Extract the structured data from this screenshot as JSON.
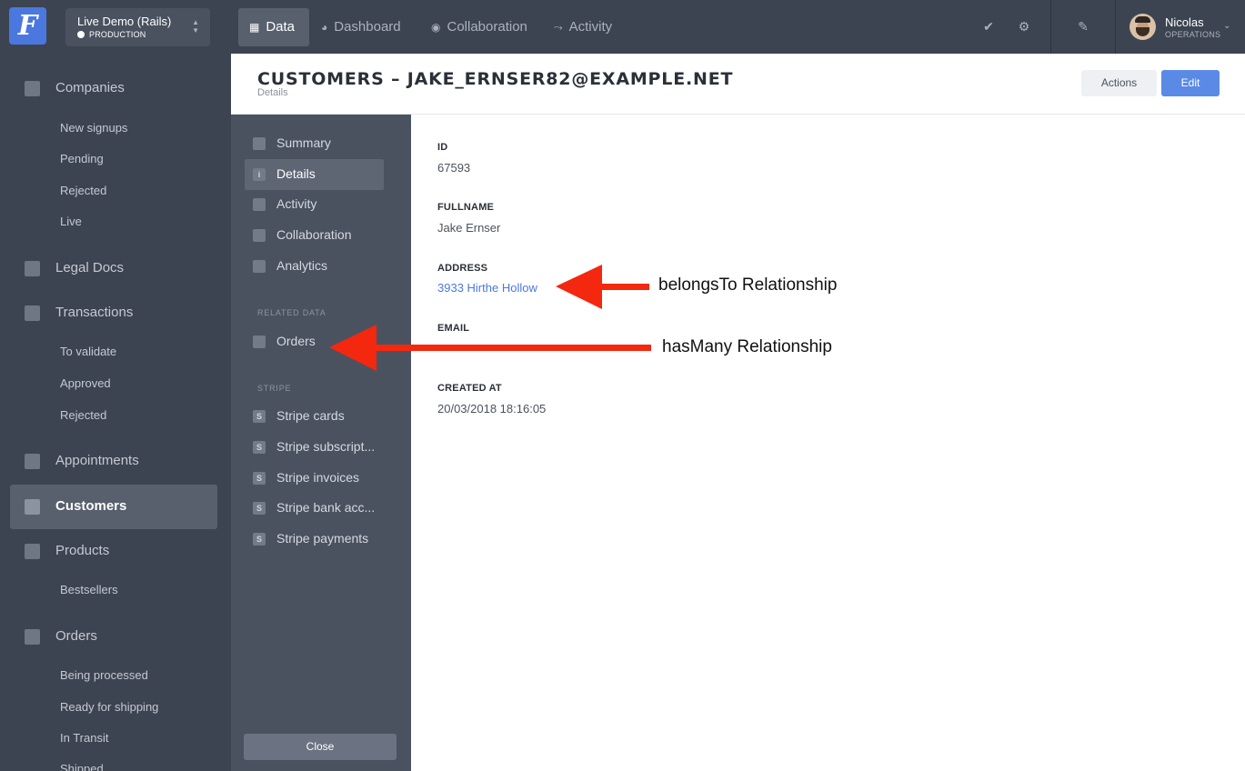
{
  "app": {
    "logo_letter": "F",
    "project_name": "Live Demo (Rails)",
    "project_env": "PRODUCTION"
  },
  "topnav": {
    "tabs": [
      {
        "label": "Data",
        "icon": "table-icon"
      },
      {
        "label": "Dashboard",
        "icon": "dashboard-icon"
      },
      {
        "label": "Collaboration",
        "icon": "chat-icon"
      },
      {
        "label": "Activity",
        "icon": "bolt-icon"
      }
    ],
    "user_name": "Nicolas",
    "user_role": "OPERATIONS"
  },
  "sidebar": {
    "companies": {
      "label": "Companies",
      "subs": [
        "New signups",
        "Pending",
        "Rejected",
        "Live"
      ]
    },
    "legal_docs": {
      "label": "Legal Docs"
    },
    "transactions": {
      "label": "Transactions",
      "subs": [
        "To validate",
        "Approved",
        "Rejected"
      ]
    },
    "appointments": {
      "label": "Appointments"
    },
    "customers": {
      "label": "Customers"
    },
    "products": {
      "label": "Products",
      "subs": [
        "Bestsellers"
      ]
    },
    "orders": {
      "label": "Orders",
      "subs": [
        "Being processed",
        "Ready for shipping",
        "In Transit",
        "Shipped"
      ]
    }
  },
  "header": {
    "title": "Customers – jake_Ernser82@example.net",
    "subtitle": "Details",
    "actions_label": "Actions",
    "edit_label": "Edit"
  },
  "record_nav": {
    "items": [
      "Summary",
      "Details",
      "Activity",
      "Collaboration",
      "Analytics"
    ],
    "related_section": "RELATED DATA",
    "related": [
      "Orders"
    ],
    "stripe_section": "STRIPE",
    "stripe": [
      "Stripe cards",
      "Stripe subscript...",
      "Stripe invoices",
      "Stripe bank acc...",
      "Stripe payments"
    ],
    "close_label": "Close"
  },
  "details": {
    "id_label": "ID",
    "id_value": "67593",
    "fullname_label": "FULLNAME",
    "fullname_value": "Jake Ernser",
    "address_label": "ADDRESS",
    "address_value": "3933 Hirthe Hollow",
    "email_label": "EMAIL",
    "created_label": "CREATED AT",
    "created_value": "20/03/2018 18:16:05"
  },
  "annotations": {
    "belongs_to": "belongsTo Relationship",
    "has_many": "hasMany Relationship"
  },
  "colors": {
    "accent": "#4b78df",
    "arrow": "#f4270f",
    "sidebar_bg": "#3d4451"
  }
}
